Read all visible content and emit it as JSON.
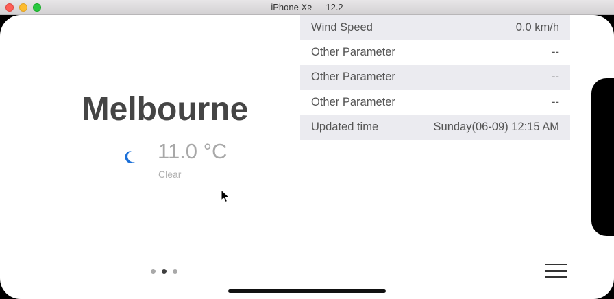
{
  "window": {
    "title": "iPhone Xʀ — 12.2"
  },
  "weather": {
    "city": "Melbourne",
    "temperature": "11.0 °C",
    "condition": "Clear",
    "icon": "moon-icon",
    "icon_color": "#1a6fd8"
  },
  "details": [
    {
      "label": "Wind Speed",
      "value": "0.0 km/h"
    },
    {
      "label": "Other Parameter",
      "value": "--"
    },
    {
      "label": "Other Parameter",
      "value": "--"
    },
    {
      "label": "Other Parameter",
      "value": "--"
    },
    {
      "label": "Updated time",
      "value": "Sunday(06-09) 12:15 AM"
    }
  ],
  "pager": {
    "page_count": 3,
    "active_index": 1
  },
  "menu": {
    "icon": "hamburger-menu-icon"
  }
}
